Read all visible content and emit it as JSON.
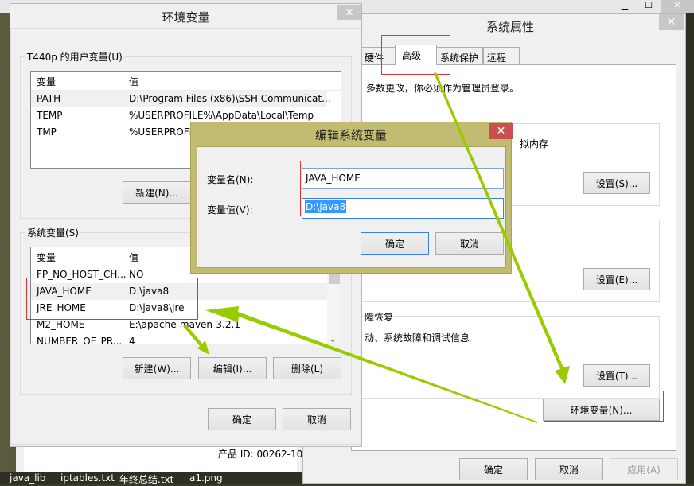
{
  "taskbar": {
    "files": [
      "java_lib",
      "iptables.txt",
      "年终总结.txt",
      "a1.png"
    ]
  },
  "background_window": {
    "product_id": "产品 ID: 00262-10"
  },
  "env_dialog": {
    "title": "环境变量",
    "close": "✕",
    "user_group": "T440p 的用户变量(U)",
    "columns": [
      "变量",
      "值"
    ],
    "user_vars": [
      {
        "name": "PATH",
        "value": "D:\\Program Files (x86)\\SSH Communicat..."
      },
      {
        "name": "TEMP",
        "value": "%USERPROFILE%\\AppData\\Local\\Temp"
      },
      {
        "name": "TMP",
        "value": "%USERPROFILE%\\AppData\\Local\\Temp"
      }
    ],
    "user_new": "新建(N)...",
    "sys_group": "系统变量(S)",
    "sys_vars": [
      {
        "name": "FP_NO_HOST_CH...",
        "value": "NO"
      },
      {
        "name": "JAVA_HOME",
        "value": "D:\\java8"
      },
      {
        "name": "JRE_HOME",
        "value": "D:\\java8\\jre"
      },
      {
        "name": "M2_HOME",
        "value": "E:\\apache-maven-3.2.1"
      },
      {
        "name": "NUMBER_OF_PR...",
        "value": "4"
      }
    ],
    "sys_new": "新建(W)...",
    "sys_edit": "编辑(I)...",
    "sys_delete": "删除(L)",
    "ok": "确定",
    "cancel": "取消"
  },
  "sys_props": {
    "title": "系统属性",
    "close": "✕",
    "tabs": [
      "硬件",
      "高级",
      "系统保护",
      "远程"
    ],
    "admin_note": "多数更改，你必须作为管理员登录。",
    "perf_text": "拟内存",
    "settings_s": "设置(S)...",
    "settings_e": "设置(E)...",
    "recovery_title": "障恢复",
    "recovery_text": "动、系统故障和调试信息",
    "settings_t": "设置(T)...",
    "env_button": "环境变量(N)...",
    "ok": "确定",
    "cancel": "取消",
    "apply": "应用(A)"
  },
  "edit_dialog": {
    "title": "编辑系统变量",
    "close": "✕",
    "name_label": "变量名(N):",
    "name_value": "JAVA_HOME",
    "value_label": "变量值(V):",
    "value_value": "D:\\java8",
    "ok": "确定",
    "cancel": "取消"
  },
  "colors": {
    "annotation_red": "#e83030",
    "arrow_green": "#99cc00",
    "edit_frame": "#c2bb72",
    "close_red": "#c75050"
  }
}
